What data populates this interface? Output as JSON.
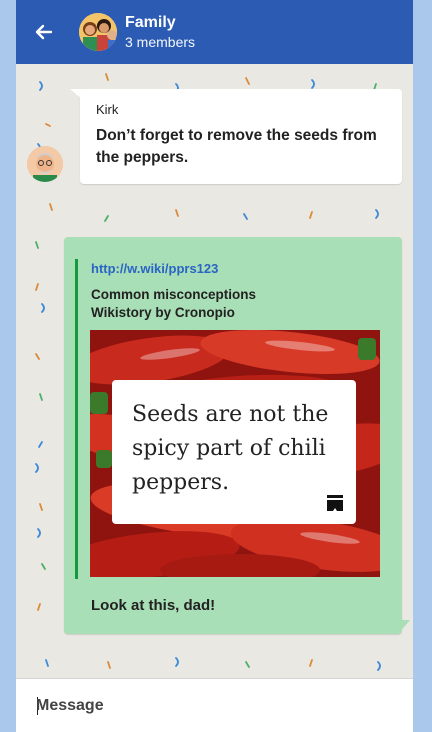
{
  "header": {
    "title": "Family",
    "subtitle": "3 members",
    "background": "#2c5bb4",
    "back_icon": "arrow-left-icon"
  },
  "messages": [
    {
      "direction": "incoming",
      "sender": "Kirk",
      "text": "Don’t forget to remove the seeds from the peppers.",
      "bubble_color": "#ffffff"
    },
    {
      "direction": "outgoing",
      "bubble_color": "#a9dfb6",
      "link_preview": {
        "url": "http://w.wiki/pprs123",
        "title": "Common misconceptions",
        "subtitle": "Wikistory by Cronopio",
        "image": "red-chili-peppers",
        "card_text": "Seeds are not the spicy part of chili peppers.",
        "card_icon": "wikistory-icon"
      },
      "text": "Look at this, dad!"
    }
  ],
  "composer": {
    "placeholder": "Message"
  }
}
